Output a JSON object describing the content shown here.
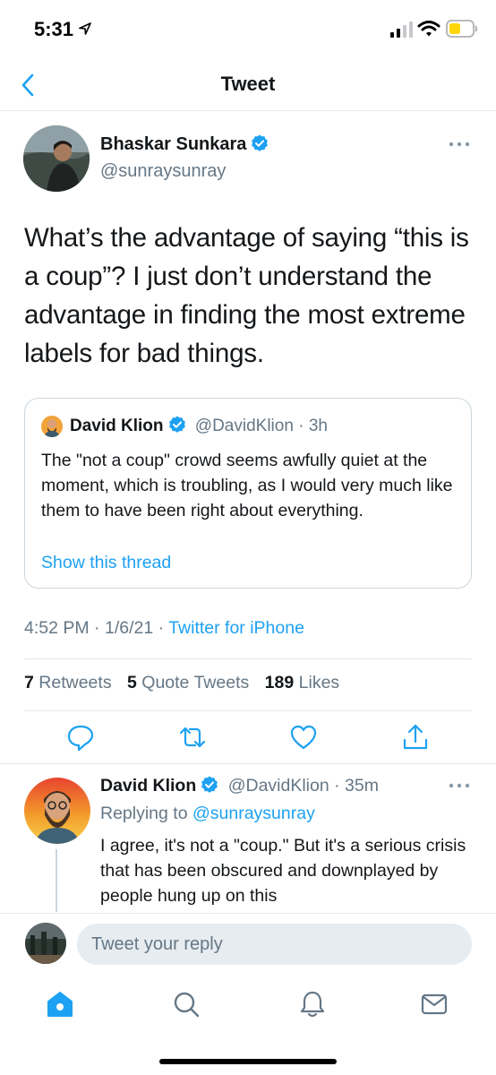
{
  "status_bar": {
    "time": "5:31"
  },
  "nav": {
    "title": "Tweet"
  },
  "tweet": {
    "author_name": "Bhaskar Sunkara",
    "author_handle": "@sunraysunray",
    "text": "What’s the advantage of saying “this is a coup”? I just don’t understand the advantage in finding the most extreme labels for bad things.",
    "time": "4:52 PM",
    "date": "1/6/21",
    "source": "Twitter for iPhone",
    "retweets": "7",
    "retweets_label": "Retweets",
    "quotes": "5",
    "quotes_label": "Quote Tweets",
    "likes": "189",
    "likes_label": "Likes"
  },
  "quote": {
    "name": "David Klion",
    "handle": "@DavidKlion",
    "age": "3h",
    "text": "The \"not a coup\" crowd seems awfully quiet at the moment, which is troubling, as I would very much like them to have been right about everything.",
    "link": "Show this thread"
  },
  "reply": {
    "name": "David Klion",
    "handle": "@DavidKlion",
    "age": "35m",
    "replying_prefix": "Replying to",
    "replying_to": "@sunraysunray",
    "text": "I agree, it's not a \"coup.\" But it's a serious crisis that has been obscured and downplayed by people hung up on this"
  },
  "composer": {
    "placeholder": "Tweet your reply"
  },
  "separators": {
    "dot": "·"
  },
  "colors": {
    "accent": "#1da1f2",
    "text": "#14171a",
    "secondary": "#657786",
    "battery": "#ffd60a"
  },
  "icons": {
    "actions": [
      "reply-icon",
      "retweet-icon",
      "like-icon",
      "share-icon"
    ],
    "tabs": [
      "home-icon",
      "search-icon",
      "notifications-icon",
      "messages-icon"
    ]
  }
}
